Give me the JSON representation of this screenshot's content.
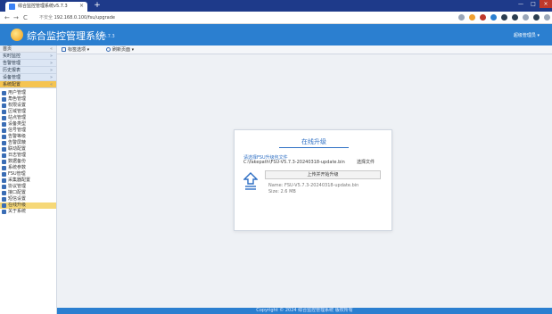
{
  "browser": {
    "tab_title": "综合监控管理系统v5.7.3",
    "tab_close": "×",
    "new_tab": "+",
    "nav_back": "←",
    "nav_forward": "→",
    "nav_reload": "C",
    "security_label": "不安全",
    "url": "192.168.0.100/fsu/upgrade",
    "window_min": "—",
    "window_max": "□",
    "window_close": "×"
  },
  "app": {
    "title": "综合监控管理系统",
    "version": "v5.7.3",
    "user": "超级管理员 ▾"
  },
  "sidebar": {
    "top_label": "首页",
    "top_arrow": "«",
    "groups": [
      {
        "label": "实时监控",
        "arrow": "»"
      },
      {
        "label": "告警管理",
        "arrow": "»"
      },
      {
        "label": "历史报表",
        "arrow": "»"
      },
      {
        "label": "设备管理",
        "arrow": "»"
      },
      {
        "label": "系统配置",
        "arrow": "«"
      }
    ],
    "items": [
      {
        "label": "用户管理"
      },
      {
        "label": "角色管理"
      },
      {
        "label": "权限设置"
      },
      {
        "label": "区域管理"
      },
      {
        "label": "站点管理"
      },
      {
        "label": "设备类型"
      },
      {
        "label": "信号管理"
      },
      {
        "label": "告警等级"
      },
      {
        "label": "告警屏蔽"
      },
      {
        "label": "联动配置"
      },
      {
        "label": "日志管理"
      },
      {
        "label": "数据备份"
      },
      {
        "label": "系统参数"
      },
      {
        "label": "FSU管理"
      },
      {
        "label": "采集器配置"
      },
      {
        "label": "协议管理"
      },
      {
        "label": "接口配置"
      },
      {
        "label": "短信设置"
      },
      {
        "label": "在线升级"
      },
      {
        "label": "关于系统"
      }
    ],
    "selected_index": 18
  },
  "toolbar": {
    "tabs_label": "标签选项 ▾",
    "refresh_label": "刷新页面 ▾"
  },
  "dialog": {
    "title": "在线升级",
    "file_label": "请选择FSU升级包文件",
    "file_value": "C:\\fakepath\\FSU-V5.7.3-20240318-update.bin",
    "browse_label": "选择文件",
    "upload_button": "上传并开始升级",
    "file_name": "Name: FSU-V5.7.3-20240318-update.bin",
    "file_size": "Size: 2.6 MB"
  },
  "footer": {
    "text": "Copyright © 2024 综合监控管理系统 版权所有"
  },
  "colors": {
    "header_blue": "#2b7fd0",
    "tab_strip": "#1e3a8a",
    "accent_blue": "#2e6fc4",
    "active_yellow": "#f5c451"
  }
}
